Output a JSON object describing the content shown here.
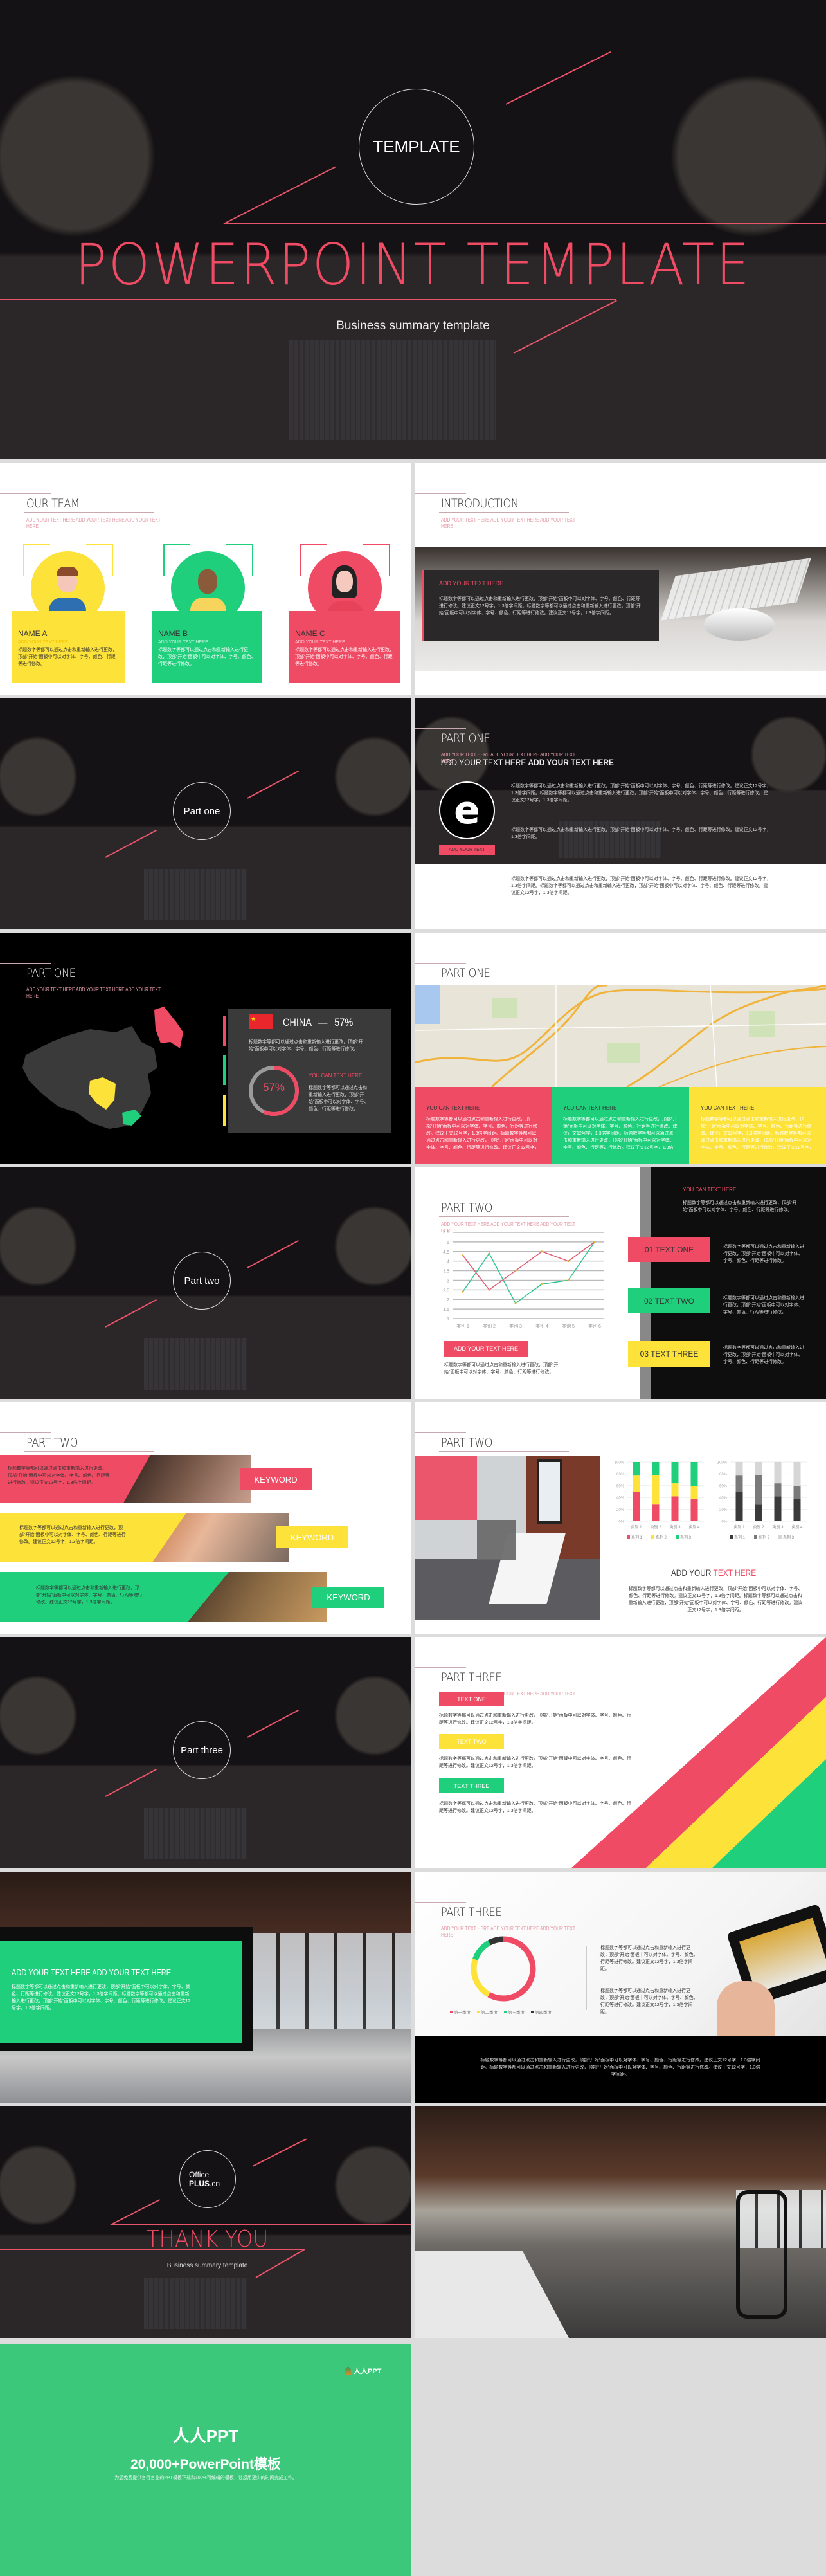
{
  "colors": {
    "accent_red": "#ef4b64",
    "yellow": "#fde23a",
    "green": "#1fcf7c",
    "dark": "#161416",
    "brand_green": "#3cc87a"
  },
  "common": {
    "placeholder": "ADD YOUR TEXT HERE ADD YOUR TEXT HERE ADD YOUR TEXT HERE",
    "body_short": "标题数字等都可以通过点击和重新输入进行更改，顶部“开始”面板中可以对字体、字号、颜色、行距等进行修改。",
    "body_long": "标题数字等都可以通过点击和重新输入进行更改，顶部“开始”面板中可以对字体、字号、颜色、行距等进行修改。建议正文12号字，1.3倍字间距。标题数字等都可以通过点击和重新输入进行更改，顶部“开始”面板中可以对字体、字号、颜色、行距等进行修改。建议正文12号字，1.3倍字间距。",
    "body_mid": "标题数字等都可以通过点击和重新输入进行更改，顶部“开始”面板中可以对字体、字号、颜色、行距等进行修改。建议正文12号字，1.3倍字间距。"
  },
  "hero": {
    "circle_label": "TEMPLATE",
    "title": "POWERPOINT TEMPLATE",
    "subtitle": "Business summary template"
  },
  "team": {
    "title": "OUR TEAM",
    "members": [
      {
        "name": "NAME A",
        "role": "ADD YOUR TEXT HERE"
      },
      {
        "name": "NAME B",
        "role": "ADD YOUR TEXT HERE"
      },
      {
        "name": "NAME C",
        "role": "ADD YOUR TEXT HERE"
      }
    ]
  },
  "intro": {
    "title": "INTRODUCTION",
    "box_heading": "ADD YOUR TEXT HERE"
  },
  "sections": {
    "one": "Part one",
    "two": "Part two",
    "three": "Part three"
  },
  "part_one_a": {
    "title": "PART ONE",
    "heading_light": "ADD YOUR TEXT HERE",
    "heading_bold": "ADD YOUR TEXT HERE",
    "button": "ADD YOUR TEXT",
    "logo_icon": "internet-explorer-icon"
  },
  "part_one_b": {
    "title": "PART ONE",
    "country": "CHINA",
    "dash": "—",
    "percent": "57%",
    "donut_label": "57%",
    "caption": "YOU CAN TEXT HERE",
    "donut_value": 57
  },
  "part_one_c": {
    "title": "PART ONE",
    "boxes": [
      {
        "heading": "YOU CAN TEXT HERE"
      },
      {
        "heading": "YOU CAN TEXT HERE"
      },
      {
        "heading": "YOU CAN TEXT HERE"
      }
    ]
  },
  "part_two_a": {
    "title": "PART TWO",
    "button": "ADD YOUR TEXT HERE",
    "panel_heading": "YOU CAN TEXT HERE",
    "tabs": [
      "01 TEXT ONE",
      "02 TEXT TWO",
      "03 TEXT THREE"
    ]
  },
  "part_two_b": {
    "title": "PART TWO",
    "keywords": [
      "KEYWORD",
      "KEYWORD",
      "KEYWORD"
    ]
  },
  "part_two_c": {
    "title": "PART TWO",
    "heading_a": "ADD YOUR ",
    "heading_b": "TEXT HERE"
  },
  "part_three_a": {
    "title": "PART THREE",
    "tags": [
      "TEXT ONE",
      "TEXT TWO",
      "TEXT THREE"
    ]
  },
  "part_three_b": {
    "heading_light": "ADD YOUR TEXT HERE",
    "heading_bold": "ADD YOUR TEXT HERE"
  },
  "part_three_c": {
    "title": "PART THREE"
  },
  "thanks": {
    "logo_line1": "Office",
    "logo_line2": "PLUS",
    "logo_line3": ".cn",
    "title": "THANK YOU",
    "subtitle": "Business summary template"
  },
  "promo": {
    "logo": "人人PPT",
    "title": "人人PPT",
    "headline": "20,000+PowerPoint模板",
    "tagline": "为您免费提供各行各业的PPT模板下载和100%可编辑的模板，让您用更少的时间完成工作。"
  },
  "chart_data": [
    {
      "type": "line",
      "categories": [
        "类别 1",
        "类别 2",
        "类别 3",
        "类别 4",
        "类别 5",
        "类别 6"
      ],
      "ylim": [
        1,
        5.5
      ],
      "yticks": [
        "1",
        "1.5",
        "2",
        "2.5",
        "3",
        "3.5",
        "4",
        "4.5",
        "5",
        "5.5"
      ],
      "grid": true,
      "series": [
        {
          "values": [
            4.3,
            2.5,
            3.5,
            4.5,
            4.0,
            5.0
          ],
          "color": "#e05a72"
        },
        {
          "values": [
            2.4,
            4.4,
            1.8,
            2.8,
            3.0,
            5.0
          ],
          "color": "#2fc68e"
        }
      ]
    },
    {
      "type": "bar",
      "stacked": true,
      "categories": [
        "类别 1",
        "类别 2",
        "类别 3",
        "类别 4"
      ],
      "ylim": [
        0,
        100
      ],
      "yticks": [
        "0%",
        "20%",
        "40%",
        "60%",
        "80%",
        "100%"
      ],
      "legend": "bottom",
      "series": [
        {
          "name": "系列 1",
          "values": [
            50,
            28,
            42,
            37
          ],
          "color": "#ef4b64"
        },
        {
          "name": "系列 2",
          "values": [
            27,
            50,
            22,
            22
          ],
          "color": "#fde23a"
        },
        {
          "name": "系列 3",
          "values": [
            23,
            22,
            36,
            41
          ],
          "color": "#1fcf7c"
        }
      ]
    },
    {
      "type": "bar",
      "stacked": true,
      "categories": [
        "类别 1",
        "类别 2",
        "类别 3",
        "类别 4"
      ],
      "ylim": [
        0,
        100
      ],
      "yticks": [
        "0%",
        "20%",
        "40%",
        "60%",
        "80%",
        "100%"
      ],
      "legend": "bottom",
      "series": [
        {
          "name": "系列 1",
          "values": [
            50,
            28,
            42,
            37
          ],
          "color": "#3a3a3a"
        },
        {
          "name": "系列 2",
          "values": [
            27,
            50,
            22,
            22
          ],
          "color": "#7a7a7a"
        },
        {
          "name": "系列 3",
          "values": [
            23,
            22,
            36,
            41
          ],
          "color": "#d6d6d6"
        }
      ]
    },
    {
      "type": "pie",
      "donut": true,
      "legend": "bottom",
      "series": [
        {
          "name": "第一季度",
          "value": 58,
          "color": "#ef4b64"
        },
        {
          "name": "第二季度",
          "value": 22,
          "color": "#fde23a"
        },
        {
          "name": "第三季度",
          "value": 12,
          "color": "#1fcf7c"
        },
        {
          "name": "第四季度",
          "value": 8,
          "color": "#333333"
        }
      ]
    }
  ]
}
